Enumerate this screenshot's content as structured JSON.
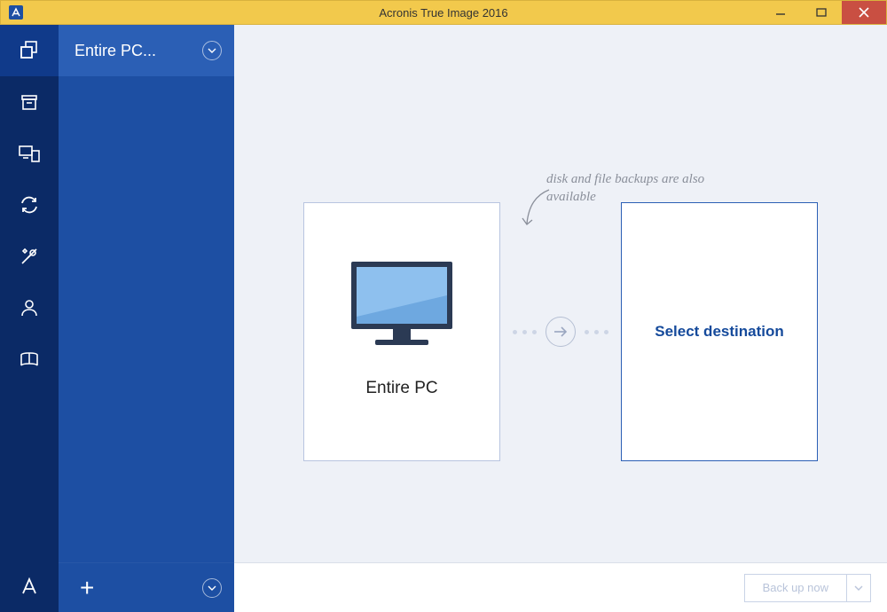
{
  "window": {
    "title": "Acronis True Image 2016"
  },
  "backup_list": {
    "selected_label": "Entire PC..."
  },
  "main": {
    "hint_text": "disk and file backups are also available",
    "source_card_label": "Entire PC",
    "dest_card_label": "Select destination"
  },
  "footer": {
    "backup_button_label": "Back up now"
  }
}
